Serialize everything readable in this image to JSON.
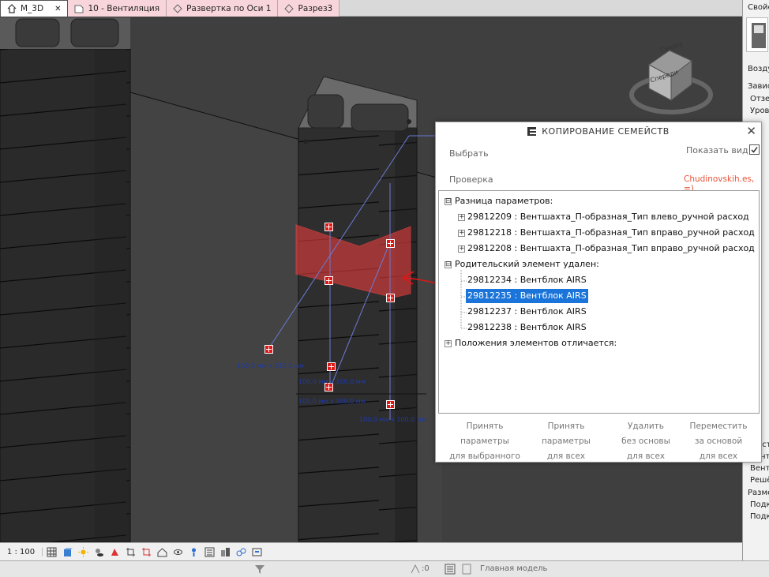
{
  "tabs": [
    {
      "label": "M_3D",
      "close": "✕",
      "active": true
    },
    {
      "label": "10 - Вентиляция"
    },
    {
      "label": "Развертка по Оси 1"
    },
    {
      "label": "Разрез3"
    }
  ],
  "properties": {
    "title": "Свойст",
    "rows": [
      "Возду",
      "Зависи",
      "Отзер",
      "Урове",
      "Текст",
      "Венти",
      "Венти",
      "Решё",
      "Размер",
      "Подкл",
      "Подкл"
    ]
  },
  "viewcube": {
    "top": "Сверху",
    "front": "Спереди"
  },
  "dialog": {
    "title": "КОПИРОВАНИЕ СЕМЕЙСТВ",
    "close": "✕",
    "select_label": "Выбрать",
    "check_label": "Проверка",
    "show_view_label": "Показать вид",
    "author": "Chudinovskih.es, =)",
    "tree": {
      "group1": {
        "label": "Разница параметров:",
        "expander": "⊟"
      },
      "group1_items": [
        {
          "label": "29812209 : Вентшахта_П-образная_Тип влево_ручной расход",
          "expander": "+"
        },
        {
          "label": "29812218 : Вентшахта_П-образная_Тип вправо_ручной расход",
          "expander": "+"
        },
        {
          "label": "29812208 : Вентшахта_П-образная_Тип вправо_ручной расход",
          "expander": "+"
        }
      ],
      "group2": {
        "label": "Родительский элемент удален:",
        "expander": "⊟"
      },
      "group2_items": [
        {
          "label": "29812234 : Вентблок AIRS"
        },
        {
          "label": "29812235 : Вентблок AIRS",
          "selected": true
        },
        {
          "label": "29812237 : Вентблок AIRS"
        },
        {
          "label": "29812238 : Вентблок AIRS"
        }
      ],
      "group3": {
        "label": "Положения элементов отличается:",
        "expander": "+"
      }
    },
    "buttons": [
      {
        "l1": "Принять",
        "l2": "параметры",
        "l3": "для выбранного"
      },
      {
        "l1": "Принять",
        "l2": "параметры",
        "l3": "для всех"
      },
      {
        "l1": "Удалить",
        "l2": "без основы",
        "l3": "для всех"
      },
      {
        "l1": "Переместить",
        "l2": "за основой",
        "l3": "для всех"
      }
    ]
  },
  "dimensions": [
    "100,0 мм x 240,0 мм",
    "100,0 мм x 100,0 мм",
    "100,0 мм x 100,0 мм",
    "100,0 мм x 100,0 мм"
  ],
  "viewbar": {
    "scale": "1 : 100"
  },
  "statusbar": {
    "coord": ":0",
    "model": "Главная модель"
  },
  "colors": {
    "accent_selection": "#1a74d9",
    "annotation": "#e01717",
    "tab_bg": "#f7d5da"
  }
}
